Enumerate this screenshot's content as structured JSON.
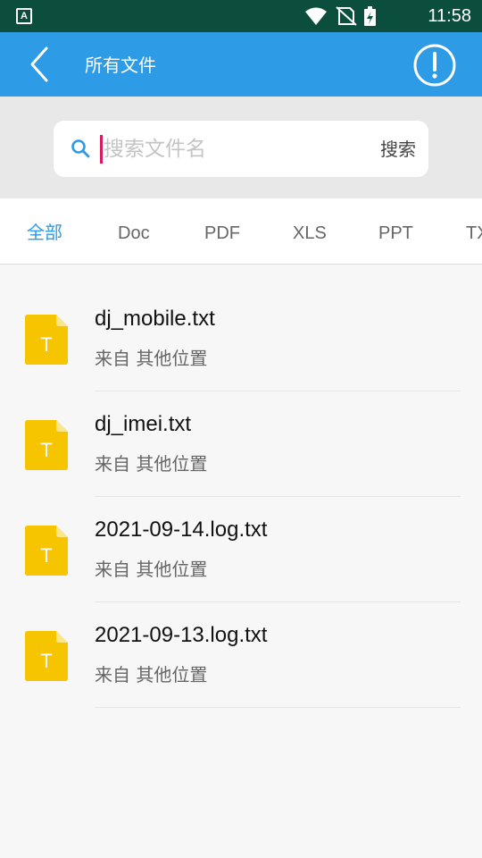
{
  "status_bar": {
    "app_badge": "A",
    "time": "11:58",
    "icons": [
      "wifi-icon",
      "no-sim-icon",
      "battery-charging-icon"
    ]
  },
  "app_bar": {
    "title": "所有文件",
    "back_icon": "chevron-left-icon",
    "info_icon": "info-circle-icon"
  },
  "search": {
    "placeholder": "搜索文件名",
    "value": "",
    "button_label": "搜索"
  },
  "tabs": [
    {
      "label": "全部",
      "active": true
    },
    {
      "label": "Doc",
      "active": false
    },
    {
      "label": "PDF",
      "active": false
    },
    {
      "label": "XLS",
      "active": false
    },
    {
      "label": "PPT",
      "active": false
    },
    {
      "label": "TXT",
      "active": false
    }
  ],
  "files": [
    {
      "name": "dj_mobile.txt",
      "source": "来自 其他位置",
      "icon_letter": "T"
    },
    {
      "name": "dj_imei.txt",
      "source": "来自 其他位置",
      "icon_letter": "T"
    },
    {
      "name": "2021-09-14.log.txt",
      "source": "来自 其他位置",
      "icon_letter": "T"
    },
    {
      "name": "2021-09-13.log.txt",
      "source": "来自 其他位置",
      "icon_letter": "T"
    }
  ],
  "colors": {
    "status_bar": "#0b4e3e",
    "app_bar": "#2e9be6",
    "accent": "#2e9be6",
    "file_icon": "#f7c500"
  }
}
